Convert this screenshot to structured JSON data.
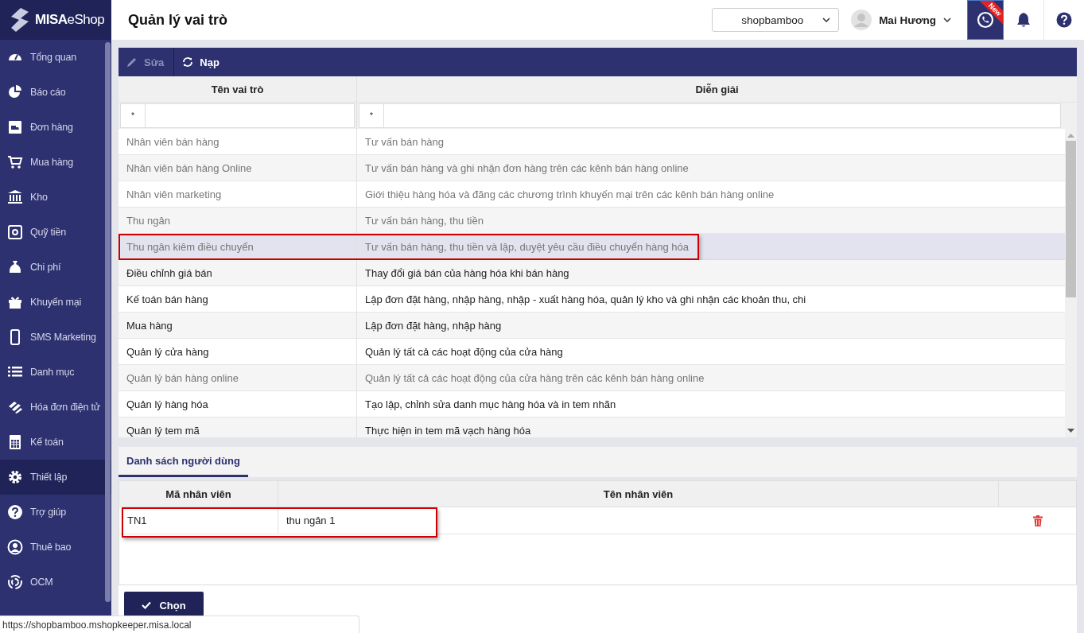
{
  "brand": {
    "name": "MISA",
    "suffix": "eShop"
  },
  "page_title": "Quản lý vai trò",
  "shop_select": {
    "value": "shopbamboo"
  },
  "user": {
    "name": "Mai Hương"
  },
  "new_badge": "New",
  "sidebar": {
    "items": [
      {
        "label": "Tổng quan",
        "selected": false
      },
      {
        "label": "Báo cáo",
        "selected": false
      },
      {
        "label": "Đơn hàng",
        "selected": false
      },
      {
        "label": "Mua hàng",
        "selected": false
      },
      {
        "label": "Kho",
        "selected": false
      },
      {
        "label": "Quỹ tiền",
        "selected": false
      },
      {
        "label": "Chi phí",
        "selected": false
      },
      {
        "label": "Khuyến mại",
        "selected": false
      },
      {
        "label": "SMS Marketing",
        "selected": false
      },
      {
        "label": "Danh mục",
        "selected": false
      },
      {
        "label": "Hóa đơn điện tử",
        "selected": false
      },
      {
        "label": "Kế toán",
        "selected": false
      },
      {
        "label": "Thiết lập",
        "selected": true
      },
      {
        "label": "Trợ giúp",
        "selected": false
      },
      {
        "label": "Thuê bao",
        "selected": false
      },
      {
        "label": "OCM",
        "selected": false
      }
    ]
  },
  "toolbar": [
    {
      "label": "Sửa",
      "disabled": true
    },
    {
      "label": "Nạp",
      "disabled": false
    }
  ],
  "roles_table": {
    "columns": [
      "Tên vai trò",
      "Diễn giải"
    ],
    "filters": [
      {
        "operator": "*"
      },
      {
        "operator": "*"
      }
    ],
    "rows": [
      {
        "name": "Nhân viên bán hàng",
        "description": "Tư vấn bán hàng",
        "muted": true,
        "selected": false,
        "highlighted": false
      },
      {
        "name": "Nhân viên bán hàng Online",
        "description": "Tư vấn bán hàng và ghi nhận đơn hàng trên các kênh bán hàng online",
        "muted": true,
        "selected": false,
        "highlighted": false
      },
      {
        "name": "Nhân viên marketing",
        "description": "Giới thiệu hàng hóa và đăng các chương trình khuyến mại trên các kênh bán hàng online",
        "muted": true,
        "selected": false,
        "highlighted": false
      },
      {
        "name": "Thu ngân",
        "description": "Tư vấn bán hàng, thu tiền",
        "muted": true,
        "selected": false,
        "highlighted": false
      },
      {
        "name": "Thu ngân kiêm điều chuyển",
        "description": "Tư vấn bán hàng, thu tiền và lập, duyệt yêu cầu điều chuyển hàng hóa",
        "muted": true,
        "selected": true,
        "highlighted": true
      },
      {
        "name": "Điều chỉnh giá bán",
        "description": "Thay đổi giá bán của hàng hóa khi bán hàng",
        "muted": false,
        "selected": false,
        "highlighted": false
      },
      {
        "name": "Kế toán bán hàng",
        "description": "Lập đơn đặt hàng, nhập hàng, nhập - xuất hàng hóa, quản lý kho và ghi nhận các khoản thu, chi",
        "muted": false,
        "selected": false,
        "highlighted": false
      },
      {
        "name": "Mua hàng",
        "description": "Lập đơn đặt hàng, nhập hàng",
        "muted": false,
        "selected": false,
        "highlighted": false
      },
      {
        "name": "Quản lý cửa hàng",
        "description": "Quản lý tất cả các hoạt động của cửa hàng",
        "muted": false,
        "selected": false,
        "highlighted": false
      },
      {
        "name": "Quản lý bán hàng online",
        "description": "Quản lý tất cả các hoạt động của cửa hàng trên các kênh bán hàng online",
        "muted": true,
        "selected": false,
        "highlighted": false
      },
      {
        "name": "Quản lý hàng hóa",
        "description": "Tạo lập, chỉnh sửa danh mục hàng hóa và in tem nhãn",
        "muted": false,
        "selected": false,
        "highlighted": false
      },
      {
        "name": "Quản lý tem mã",
        "description": "Thực hiện in tem mã vạch hàng hóa",
        "muted": false,
        "selected": false,
        "highlighted": false
      }
    ]
  },
  "detail_tabs": [
    {
      "label": "Danh sách người dùng",
      "selected": true
    }
  ],
  "users_table": {
    "columns": [
      "Mã nhân viên",
      "Tên nhân viên"
    ],
    "rows": [
      {
        "code": "TN1",
        "name": "thu ngân 1",
        "highlighted": true
      }
    ]
  },
  "choose_button": "Chọn",
  "status_url": "https://shopbamboo.mshopkeeper.misa.local"
}
